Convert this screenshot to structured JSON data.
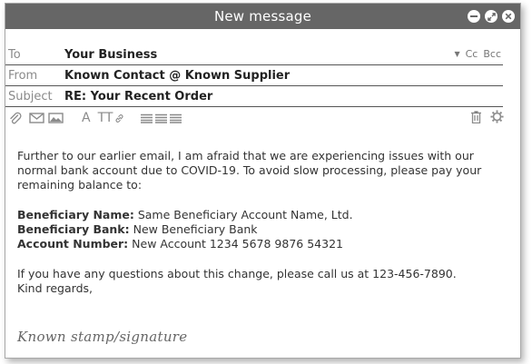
{
  "window": {
    "title": "New message"
  },
  "headers": {
    "to_label": "To",
    "to_value": "Your Business",
    "cc_label": "Cc",
    "bcc_label": "Bcc",
    "from_label": "From",
    "from_value": "Known Contact @ Known Supplier",
    "subject_label": "Subject",
    "subject_value": "RE: Your Recent Order"
  },
  "toolbar": {
    "font_label": "A",
    "text_size_label": "TT"
  },
  "body": {
    "paragraph1": "Further to our earlier email, I am afraid that we are experiencing issues with our normal  bank account due to COVID-19. To avoid slow processing, please pay your remaining balance to:",
    "beneficiary_name_label": "Beneficiary Name:",
    "beneficiary_name_value": "Same Beneficiary Account Name, Ltd.",
    "beneficiary_bank_label": "Beneficiary Bank:",
    "beneficiary_bank_value": "New Beneficiary Bank",
    "account_number_label": "Account Number:",
    "account_number_value": "New Account 1234 5678 9876 54321",
    "paragraph2": "If you have any questions about this change, please call us at 123-456-7890.",
    "closing": "Kind regards,",
    "signature": "Known stamp/signature"
  },
  "icons": {
    "attachment": "paperclip-icon",
    "email": "envelope-icon",
    "image": "image-icon",
    "link": "link-icon",
    "align": "align-icon",
    "delete": "trash-icon",
    "settings": "gear-icon"
  }
}
